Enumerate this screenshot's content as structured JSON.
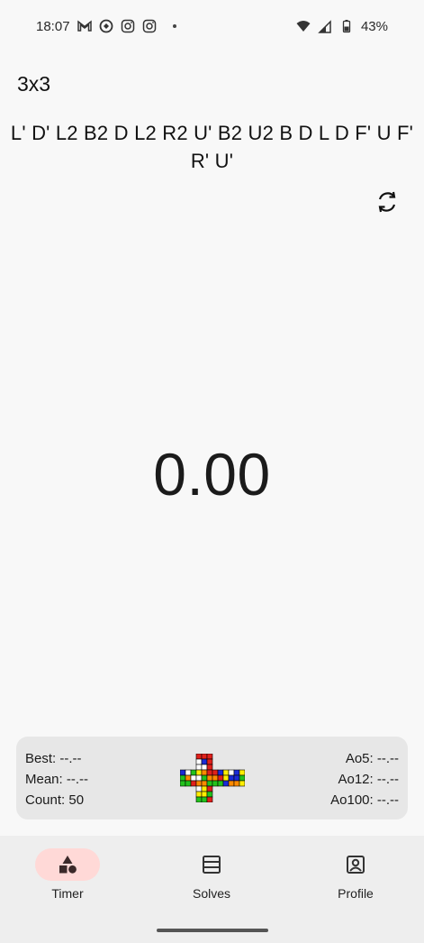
{
  "status_bar": {
    "time": "18:07",
    "battery": "43%",
    "icons": [
      "gmail-icon",
      "photos-sync-icon",
      "instagram-icon",
      "instagram-icon",
      "notification-dot",
      "wifi-icon",
      "signal-icon",
      "battery-icon"
    ]
  },
  "puzzle": "3x3",
  "scramble": "L' D' L2 B2 D L2 R2 U' B2 U2 B D L D F' U F' R' U'",
  "timer": "0.00",
  "stats": {
    "best": "Best: --.--",
    "mean": "Mean: --.--",
    "count": "Count: 50",
    "ao5": "Ao5: --.--",
    "ao12": "Ao12: --.--",
    "ao100": "Ao100: --.--"
  },
  "cube_colors": {
    "white": "#ffffff",
    "yellow": "#ffee00",
    "red": "#e0201b",
    "orange": "#ff8a00",
    "blue": "#1a2bd6",
    "green": "#22c21c"
  },
  "nav": {
    "timer": "Timer",
    "solves": "Solves",
    "profile": "Profile"
  },
  "accent": "#ffd9d7"
}
